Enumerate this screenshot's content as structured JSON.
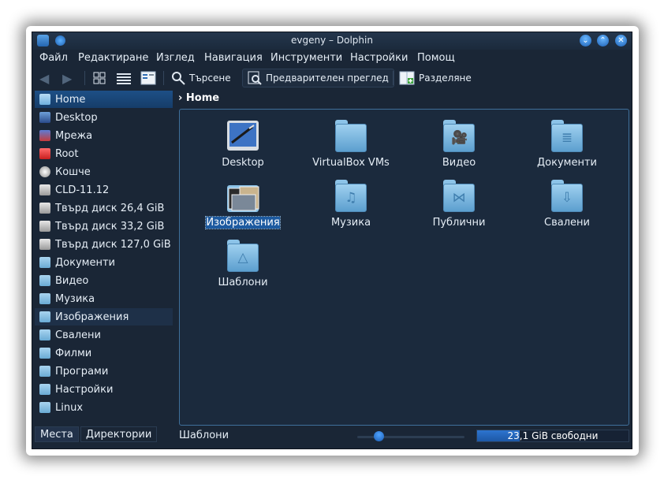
{
  "window": {
    "title": "evgeny – Dolphin"
  },
  "menubar": [
    "Файл",
    "Редактиране",
    "Изглед",
    "Навигация",
    "Инструменти",
    "Настройки",
    "Помощ"
  ],
  "toolbar": {
    "search_label": "Търсене",
    "preview_label": "Предварителен преглед",
    "split_label": "Разделяне"
  },
  "places": [
    {
      "label": "Home",
      "icon": "home-folder-icon",
      "selected": true
    },
    {
      "label": "Desktop",
      "icon": "desktop-icon"
    },
    {
      "label": "Мрежа",
      "icon": "network-icon"
    },
    {
      "label": "Root",
      "icon": "root-folder-icon"
    },
    {
      "label": "Кошче",
      "icon": "trash-icon"
    },
    {
      "label": "CLD-11.12",
      "icon": "drive-icon"
    },
    {
      "label": "Твърд диск 26,4 GiB",
      "icon": "drive-icon"
    },
    {
      "label": "Твърд диск 33,2 GiB",
      "icon": "drive-icon"
    },
    {
      "label": "Твърд диск 127,0 GiB",
      "icon": "drive-icon"
    },
    {
      "label": "Документи",
      "icon": "documents-folder-icon"
    },
    {
      "label": "Видео",
      "icon": "video-folder-icon"
    },
    {
      "label": "Музика",
      "icon": "music-folder-icon"
    },
    {
      "label": "Изображения",
      "icon": "pictures-folder-icon"
    },
    {
      "label": "Свалени",
      "icon": "downloads-folder-icon"
    },
    {
      "label": "Филми",
      "icon": "movies-folder-icon"
    },
    {
      "label": "Програми",
      "icon": "programs-folder-icon"
    },
    {
      "label": "Настройки",
      "icon": "settings-folder-icon"
    },
    {
      "label": "Linux",
      "icon": "folder-icon"
    }
  ],
  "panel_tabs": [
    "Места",
    "Директории"
  ],
  "breadcrumb": {
    "current": "Home"
  },
  "files": [
    {
      "name": "Desktop",
      "icon": "desktop-icon"
    },
    {
      "name": "VirtualBox VMs",
      "icon": "folder-icon"
    },
    {
      "name": "Видео",
      "icon": "video-folder-icon"
    },
    {
      "name": "Документи",
      "icon": "documents-folder-icon"
    },
    {
      "name": "Изображения",
      "icon": "pictures-folder-icon",
      "selected": true
    },
    {
      "name": "Музика",
      "icon": "music-folder-icon"
    },
    {
      "name": "Публични",
      "icon": "share-folder-icon"
    },
    {
      "name": "Свалени",
      "icon": "downloads-folder-icon"
    },
    {
      "name": "Шаблони",
      "icon": "templates-folder-icon"
    }
  ],
  "statusbar": {
    "text": "Шаблони",
    "zoom_fraction": 0.2,
    "free_space": "23,1 GiB свободни",
    "used_fraction": 0.28
  }
}
